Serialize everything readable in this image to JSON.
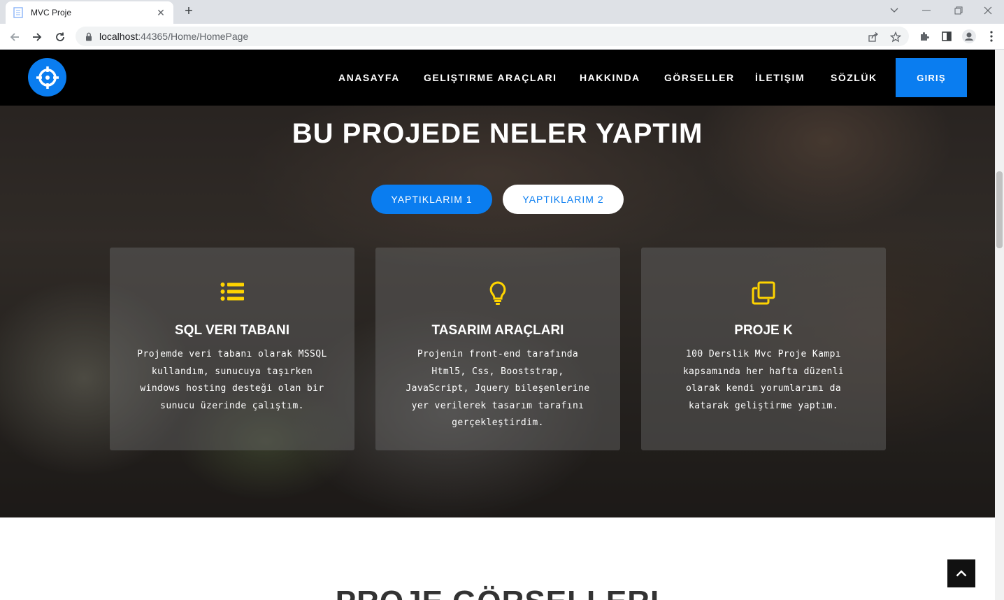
{
  "browser": {
    "tab_title": "MVC Proje",
    "url_host": "localhost",
    "url_rest": ":44365/Home/HomePage"
  },
  "navbar": {
    "links": [
      "ANASAYFA",
      "GELIŞTIRME ARAÇLARI",
      "HAKKINDA",
      "GÖRSELLER",
      "İLETIŞIM",
      "SÖZLÜK"
    ],
    "login_label": "GIRIŞ"
  },
  "hero": {
    "title": "BU PROJEDE NELER YAPTIM",
    "tabs": [
      "YAPTIKLARIM 1",
      "YAPTIKLARIM 2"
    ],
    "cards": [
      {
        "icon": "list-icon",
        "title": "SQL VERI TABANI",
        "text": "Projemde veri tabanı olarak MSSQL kullandım, sunucuya taşırken windows hosting desteği olan bir sunucu üzerinde çalıştım."
      },
      {
        "icon": "lightbulb-icon",
        "title": "TASARIM ARAÇLARI",
        "text": "Projenin front-end tarafında Html5, Css, Booststrap, JavaScript, Jquery bileşenlerine yer verilerek tasarım tarafını gerçekleştirdim."
      },
      {
        "icon": "copy-icon",
        "title": "PROJE K",
        "text": "100 Derslik Mvc Proje Kampı kapsamında her hafta düzenli olarak kendi yorumlarımı da katarak geliştirme yaptım."
      }
    ]
  },
  "section": {
    "title": "PROJE GÖRSELLERI"
  },
  "colors": {
    "accent": "#0a7df0",
    "icon": "#ffd400"
  }
}
